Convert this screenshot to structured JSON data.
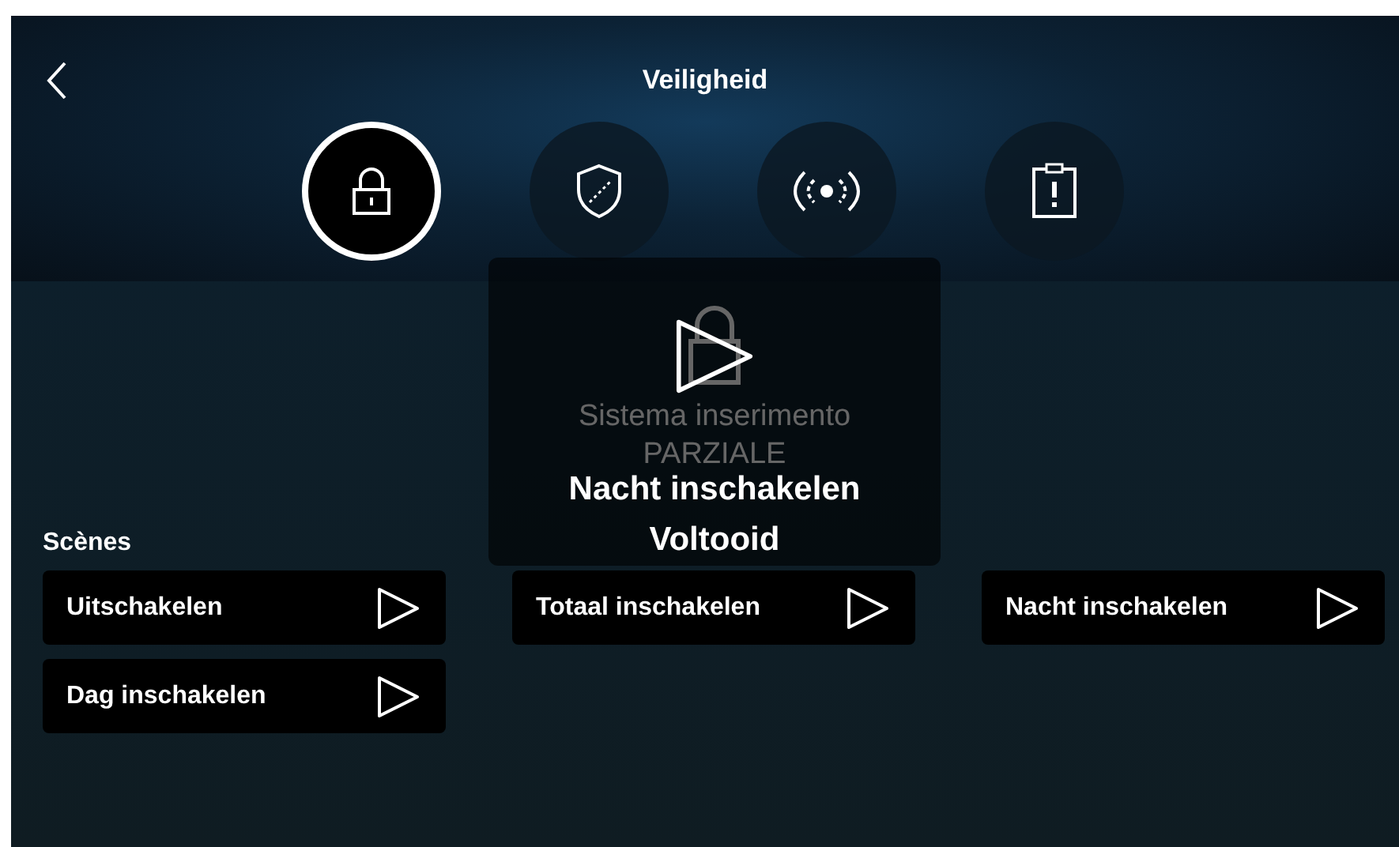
{
  "header": {
    "title": "Veiligheid"
  },
  "tabs": [
    {
      "kind": "lock",
      "selected": true
    },
    {
      "kind": "shield",
      "selected": false
    },
    {
      "kind": "signal",
      "selected": false
    },
    {
      "kind": "clipboard",
      "selected": false
    }
  ],
  "status": {
    "text": "Sistema inserimento PARZIALE"
  },
  "scenes": {
    "title": "Scènes",
    "columns": [
      [
        {
          "label": "Uitschakelen"
        },
        {
          "label": "Dag inschakelen"
        }
      ],
      [
        {
          "label": "Totaal inschakelen"
        }
      ],
      [
        {
          "label": "Nacht inschakelen"
        }
      ]
    ]
  },
  "overlay": {
    "lines": [
      "Nacht inschakelen",
      "Voltooid"
    ]
  }
}
